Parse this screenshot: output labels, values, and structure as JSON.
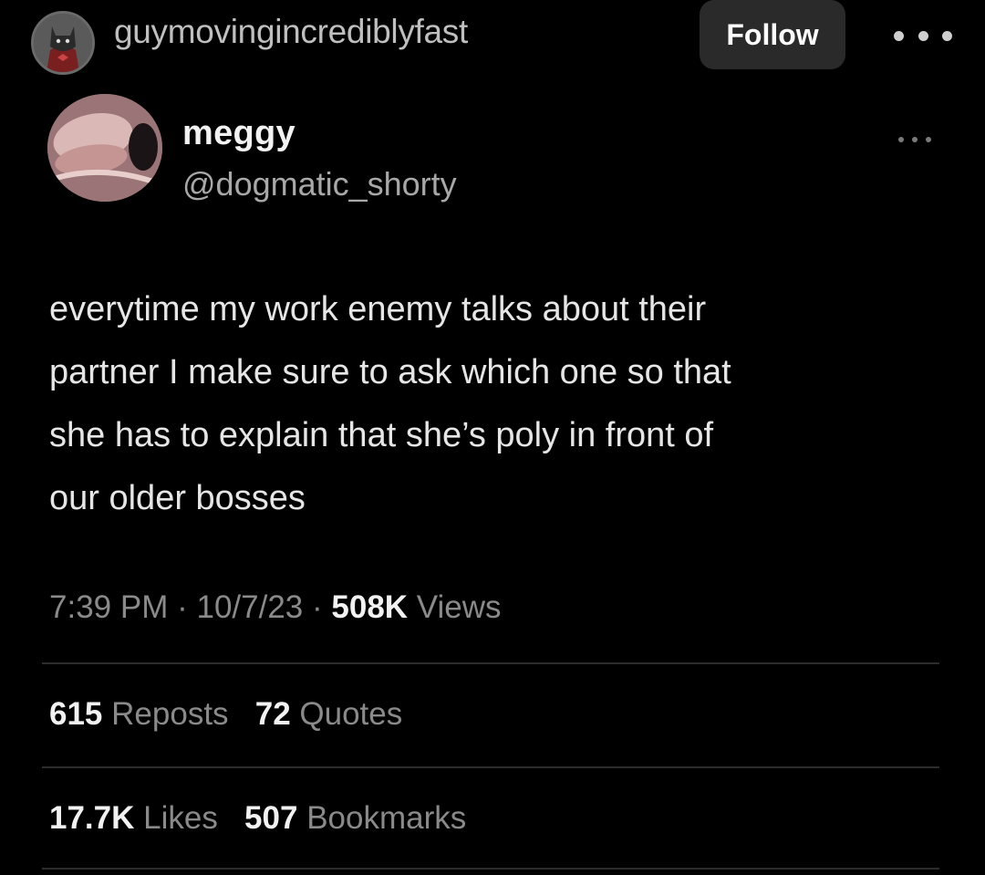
{
  "post": {
    "avatar_icon": "masked-hero-avatar-icon",
    "username": "guymovingincrediblyfast",
    "follow_label": "Follow",
    "more_icon": "more-options-icon"
  },
  "tweet": {
    "display_name": "meggy",
    "handle": "@dogmatic_shorty",
    "text": "everytime my work enemy talks about their\npartner I make sure to ask which one so that\nshe has to explain that she’s poly in front of\nour older bosses",
    "time": "7:39 PM",
    "date": "10/7/23",
    "separator": "·",
    "views_count": "508K",
    "views_label": "Views",
    "reposts_count": "615",
    "reposts_label": "Reposts",
    "quotes_count": "72",
    "quotes_label": "Quotes",
    "likes_count": "17.7K",
    "likes_label": "Likes",
    "bookmarks_count": "507",
    "bookmarks_label": "Bookmarks"
  },
  "colors": {
    "background": "#000000",
    "follow_button_bg": "#2a2a2a",
    "primary_text": "#f2f2f2",
    "secondary_text": "#8a8a8a"
  }
}
